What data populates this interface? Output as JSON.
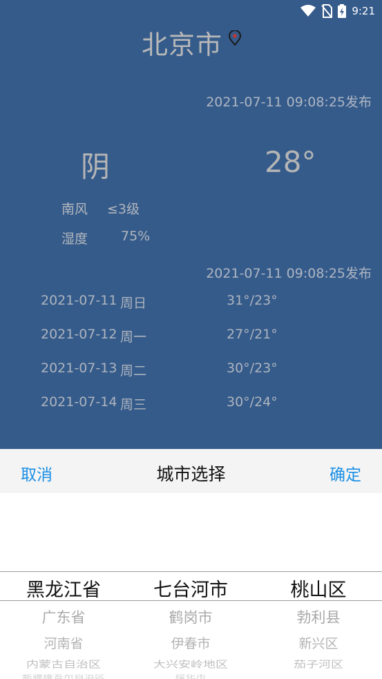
{
  "status_bar": {
    "time": "9:21",
    "icons": [
      "wifi-icon",
      "no-sim-icon",
      "battery-charging-icon"
    ]
  },
  "weather": {
    "city": "北京市",
    "location_icon": "location-pin-icon",
    "publish_time": "2021-07-11 09:08:25发布",
    "condition": "阴",
    "temperature": "28°",
    "wind_label": "南风",
    "wind_value": "≤3级",
    "humidity_label": "湿度",
    "humidity_value": "75%",
    "forecast_publish_time": "2021-07-11 09:08:25发布",
    "forecast": [
      {
        "date": "2021-07-11",
        "weekday": "周日",
        "temp": "31°/23°"
      },
      {
        "date": "2021-07-12",
        "weekday": "周一",
        "temp": "27°/21°"
      },
      {
        "date": "2021-07-13",
        "weekday": "周二",
        "temp": "30°/23°"
      },
      {
        "date": "2021-07-14",
        "weekday": "周三",
        "temp": "30°/24°"
      }
    ]
  },
  "picker": {
    "cancel_label": "取消",
    "title": "城市选择",
    "confirm_label": "确定",
    "provinces": [
      "黑龙江省",
      "广东省",
      "河南省",
      "内蒙古自治区",
      "新疆维吾尔自治区"
    ],
    "cities": [
      "七台河市",
      "鹤岗市",
      "伊春市",
      "大兴安岭地区",
      "绥化市"
    ],
    "districts": [
      "桃山区",
      "勃利县",
      "新兴区",
      "茄子河区"
    ]
  },
  "colors": {
    "panel_bg": "#355b8b",
    "accent": "#1a8fe6"
  }
}
